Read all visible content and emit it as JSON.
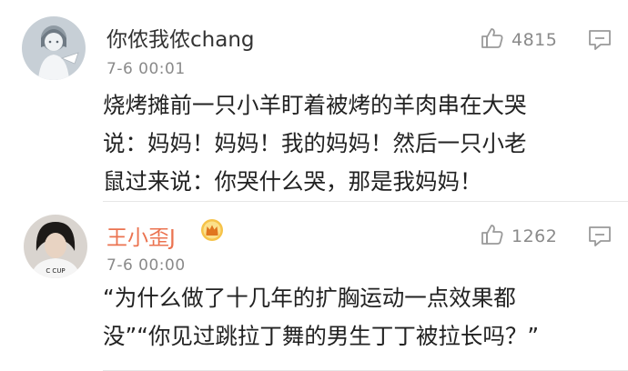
{
  "comments": [
    {
      "username": "你侬我侬chang",
      "time": "7-6 00:01",
      "likes": "4815",
      "text_lines": [
        "烧烤摊前一只小羊盯着被烤的羊肉串在大哭",
        "说：妈妈！妈妈！我的妈妈！然后一只小老",
        "鼠过来说：你哭什么哭，那是我妈妈！"
      ]
    },
    {
      "username": "王小歪J",
      "time": "7-6 00:00",
      "likes": "1262",
      "avatar_shirt_text": "C CUP",
      "text_lines": [
        "“为什么做了十几年的扩胸运动一点效果都",
        "没”“你见过跳拉丁舞的男生丁丁被拉长吗？”"
      ]
    }
  ],
  "colors": {
    "username_default": "#333333",
    "username_vip": "#eb7350",
    "meta_gray": "#8a8a8a",
    "body_text": "#222222"
  },
  "icons": {
    "like": "thumbs-up-icon",
    "reply": "comment-bubble-icon",
    "vip": "crown-badge-icon"
  }
}
